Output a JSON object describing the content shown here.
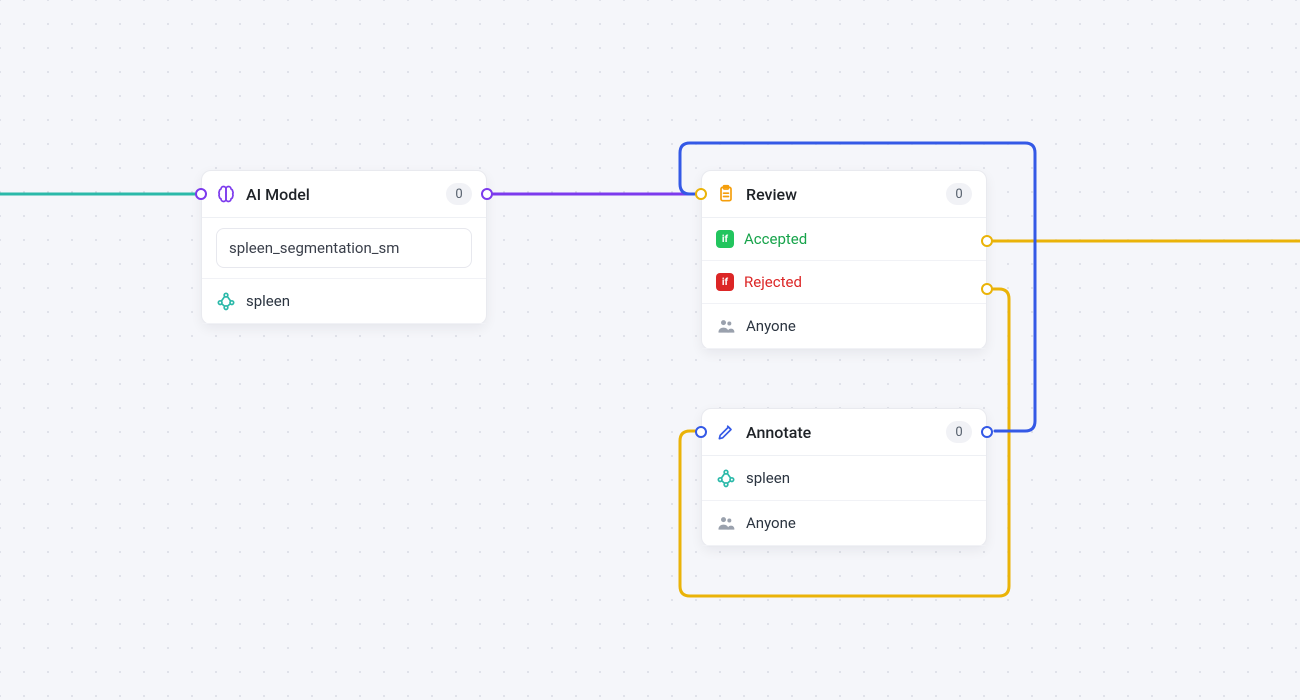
{
  "nodes": {
    "ai_model": {
      "title": "AI Model",
      "count": "0",
      "model_name": "spleen_segmentation_sm",
      "tag": "spleen"
    },
    "review": {
      "title": "Review",
      "count": "0",
      "accepted_label": "Accepted",
      "rejected_label": "Rejected",
      "assignee": "Anyone",
      "if_badge": "if"
    },
    "annotate": {
      "title": "Annotate",
      "count": "0",
      "tag": "spleen",
      "assignee": "Anyone"
    }
  },
  "colors": {
    "teal": "#2bb9a9",
    "purple": "#7c3aed",
    "orange": "#eab308",
    "blue": "#3459e6"
  }
}
